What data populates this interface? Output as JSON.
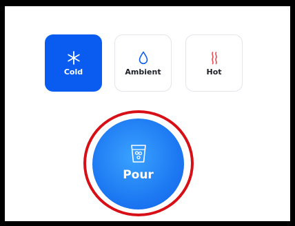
{
  "modes": [
    {
      "id": "cold",
      "label": "Cold",
      "icon": "snowflake-icon",
      "selected": true
    },
    {
      "id": "ambient",
      "label": "Ambient",
      "icon": "droplet-icon",
      "selected": false
    },
    {
      "id": "hot",
      "label": "Hot",
      "icon": "steam-icon",
      "selected": false
    }
  ],
  "pour": {
    "label": "Pour",
    "icon": "glass-icon"
  },
  "colors": {
    "accent": "#0a5cf0",
    "hot_icon": "#e8484f",
    "highlight_ring": "#d70f16"
  }
}
